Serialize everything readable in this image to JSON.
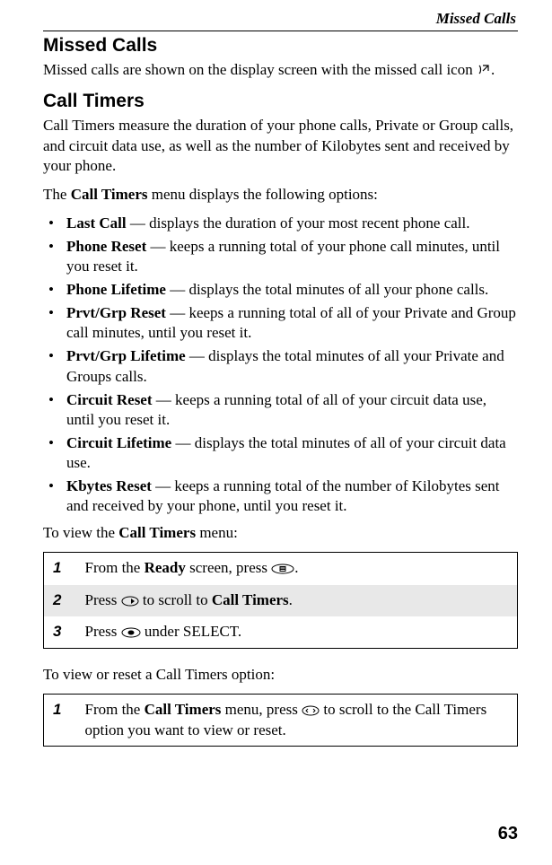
{
  "running_header": "Missed Calls",
  "page_number": "63",
  "section1": {
    "heading": "Missed Calls",
    "para1_a": "Missed calls are shown on the display screen with the missed call icon ",
    "para1_b": "."
  },
  "section2": {
    "heading": "Call Timers",
    "para1": "Call Timers measure the duration of your phone calls, Private or Group calls, and circuit data use, as well as the number of Kilobytes sent and received by your phone.",
    "para2_a": "The ",
    "para2_bold": "Call Timers",
    "para2_b": " menu displays the following options:",
    "items": [
      {
        "term": "Last Call",
        "desc": " — displays the duration of your most recent phone call."
      },
      {
        "term": "Phone Reset",
        "desc": " — keeps a running total of your phone call minutes, until you reset it."
      },
      {
        "term": "Phone Lifetime",
        "desc": " — displays the total minutes of all your phone calls."
      },
      {
        "term": "Prvt/Grp Reset",
        "desc": " — keeps a running total of all of your Private and Group call minutes, until you reset it."
      },
      {
        "term": "Prvt/Grp Lifetime",
        "desc": " — displays the total minutes of all your Private and Groups calls."
      },
      {
        "term": "Circuit Reset",
        "desc": " — keeps a running total of all of your circuit data use, until you reset it."
      },
      {
        "term": "Circuit Lifetime",
        "desc": " — displays the total minutes of all of your circuit data use."
      },
      {
        "term": "Kbytes Reset",
        "desc": " — keeps a running total of the number of Kilobytes sent and received by your phone, until you reset it."
      }
    ],
    "para3_a": "To view the ",
    "para3_bold": "Call Timers",
    "para3_b": " menu:",
    "steps1": {
      "r1": {
        "num": "1",
        "a": "From the ",
        "b1": "Ready",
        "c": " screen, press ",
        "d": "."
      },
      "r2": {
        "num": "2",
        "a": "Press ",
        "c": " to scroll to ",
        "b1": "Call Timers",
        "d": "."
      },
      "r3": {
        "num": "3",
        "a": "Press ",
        "c": " under SELECT."
      }
    },
    "para4": "To view or reset a Call Timers option:",
    "steps2": {
      "r1": {
        "num": "1",
        "a": "From the ",
        "b1": "Call Timers",
        "c": " menu, press ",
        "d": " to scroll to the Call Timers option you want to view or reset."
      }
    }
  }
}
